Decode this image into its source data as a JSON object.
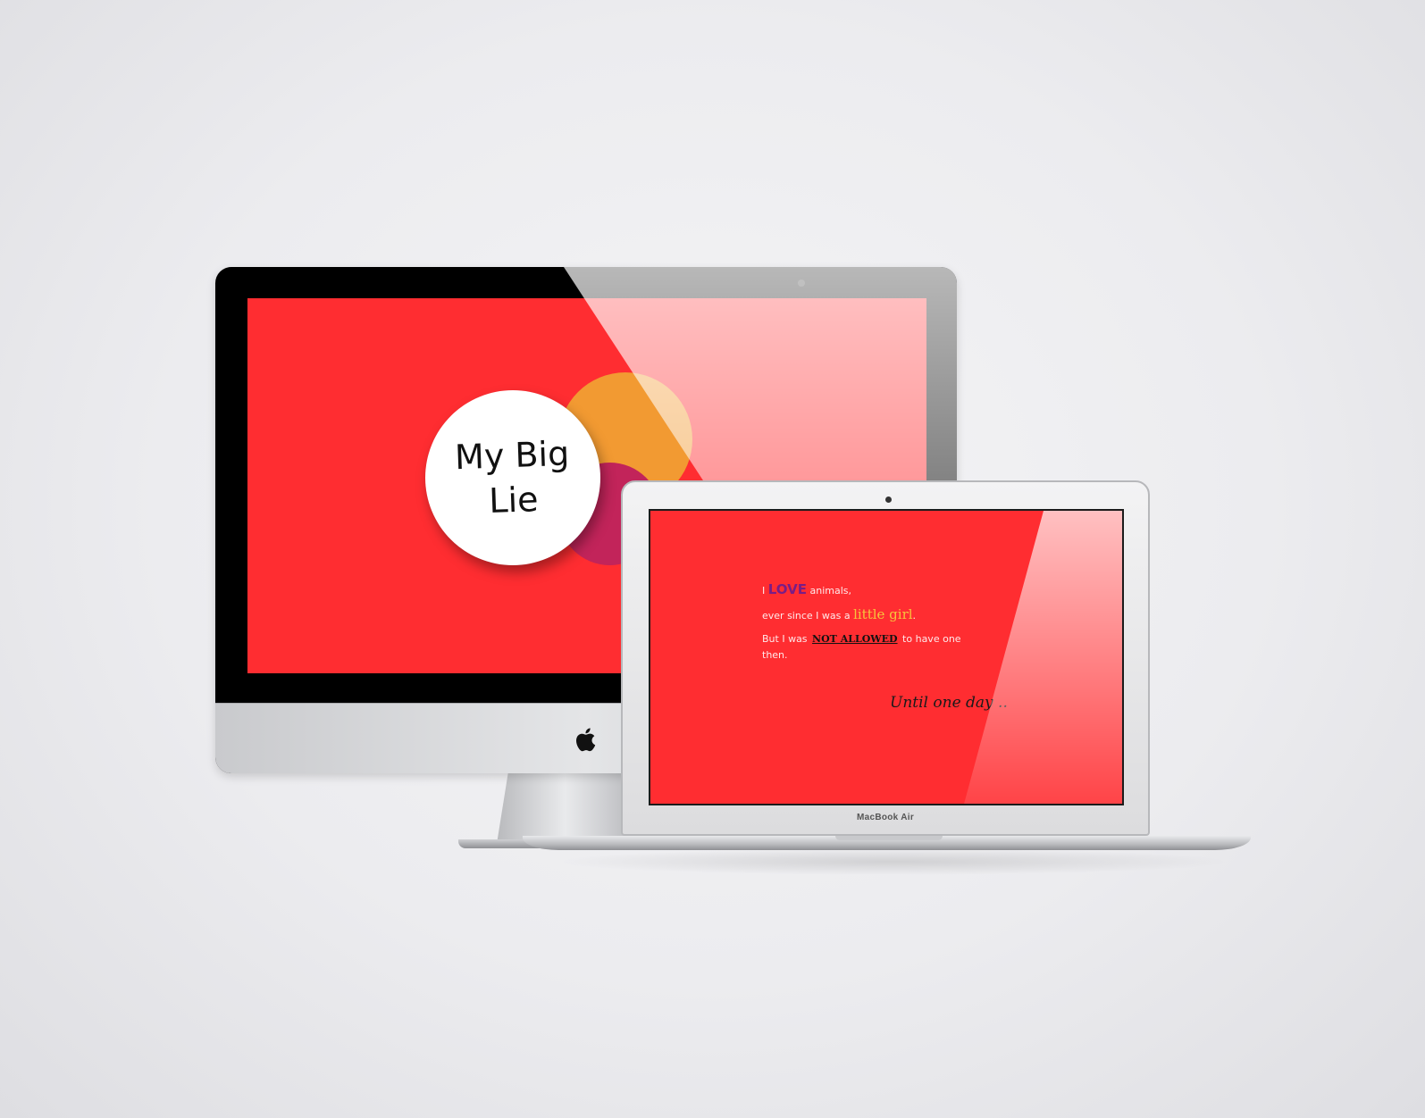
{
  "imac_screen": {
    "title_line1": "My Big",
    "title_line2": "Lie",
    "background_color": "#ff2d31",
    "accent_colors": [
      "#f29a32",
      "#c2245a",
      "#ffffff"
    ]
  },
  "macbook_screen": {
    "line1": {
      "pre": "I ",
      "highlight": "LOVE",
      "post": " animals,"
    },
    "line2": {
      "pre": "ever since I was a ",
      "highlight": "little girl",
      "post": "."
    },
    "line3": {
      "pre": "But I was ",
      "highlight": "NOT  ALLOWED",
      "post": " to have one"
    },
    "line4": "then.",
    "closing": "Until one day ..",
    "device_label": "MacBook Air",
    "background_color": "#ff2d31"
  },
  "icons": {
    "imac_logo": "apple-logo-icon"
  }
}
